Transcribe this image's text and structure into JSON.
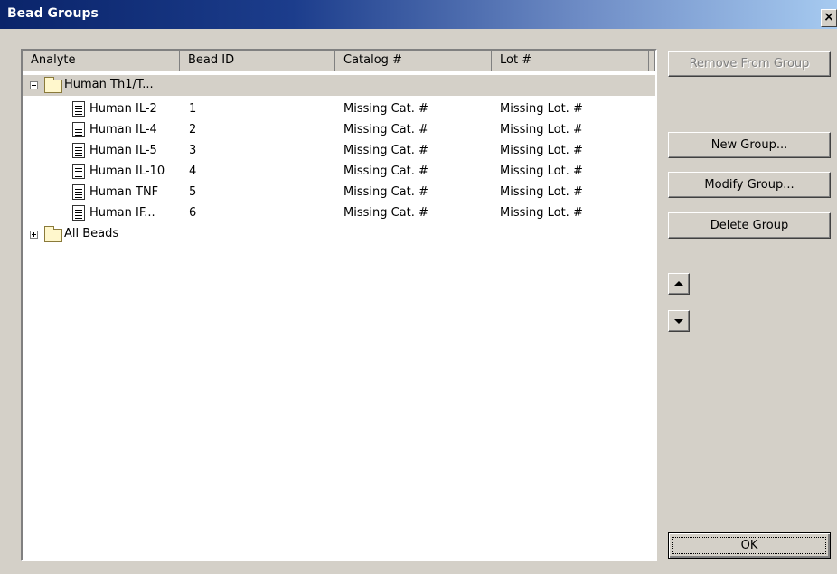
{
  "window": {
    "title": "Bead Groups",
    "close_glyph": "×"
  },
  "columns": [
    "Analyte",
    "Bead ID",
    "Catalog #",
    "Lot #"
  ],
  "groups": [
    {
      "name": "Human Th1/T...",
      "expanded": true,
      "items": [
        {
          "analyte": "Human IL-2",
          "bead_id": "1",
          "catalog": "Missing Cat. #",
          "lot": "Missing Lot. #"
        },
        {
          "analyte": "Human IL-4",
          "bead_id": "2",
          "catalog": "Missing Cat. #",
          "lot": "Missing Lot. #"
        },
        {
          "analyte": "Human IL-5",
          "bead_id": "3",
          "catalog": "Missing Cat. #",
          "lot": "Missing Lot. #"
        },
        {
          "analyte": "Human IL-10",
          "bead_id": "4",
          "catalog": "Missing Cat. #",
          "lot": "Missing Lot. #"
        },
        {
          "analyte": "Human TNF",
          "bead_id": "5",
          "catalog": "Missing Cat. #",
          "lot": "Missing Lot. #"
        },
        {
          "analyte": "Human IF...",
          "bead_id": "6",
          "catalog": "Missing Cat. #",
          "lot": "Missing Lot. #"
        }
      ]
    },
    {
      "name": "All Beads",
      "expanded": false,
      "items": []
    }
  ],
  "buttons": {
    "remove_from_group": "Remove From Group",
    "new_group": "New Group...",
    "modify_group": "Modify Group...",
    "delete_group": "Delete Group",
    "ok": "OK"
  },
  "icons": {
    "move_up": "triangle-up-icon",
    "move_down": "triangle-down-icon",
    "folder": "folder-icon",
    "document": "document-icon"
  },
  "colors": {
    "titlebar_start": "#0a246a",
    "titlebar_end": "#a6caf0",
    "dialog_bg": "#d4d0c8",
    "list_bg": "#ffffff",
    "disabled_text": "#808080"
  }
}
